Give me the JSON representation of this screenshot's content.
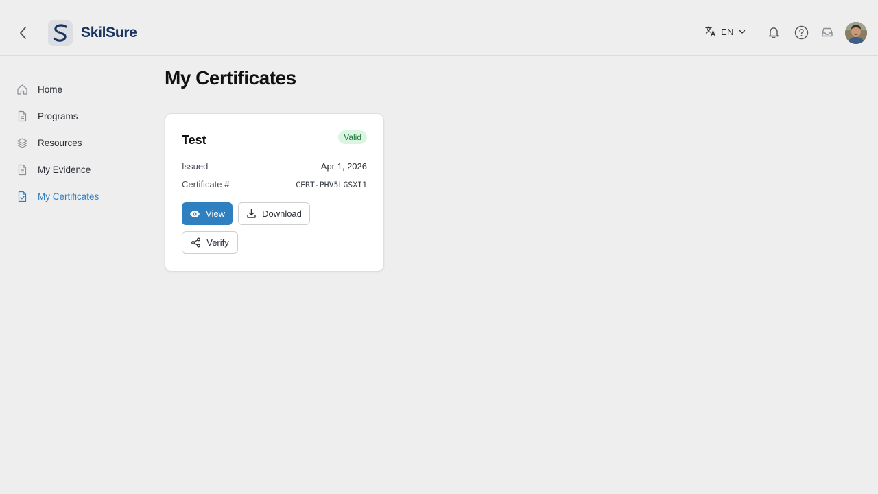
{
  "header": {
    "brand": "SkilSure",
    "language": {
      "code": "EN"
    },
    "icons": [
      "chevron-left-icon",
      "translate-icon",
      "chevron-down-icon",
      "bell-icon",
      "help-icon",
      "inbox-icon"
    ]
  },
  "sidebar": {
    "items": [
      {
        "label": "Home",
        "icon": "home-icon",
        "active": false
      },
      {
        "label": "Programs",
        "icon": "document-icon",
        "active": false
      },
      {
        "label": "Resources",
        "icon": "layers-icon",
        "active": false
      },
      {
        "label": "My Evidence",
        "icon": "document-icon",
        "active": false
      },
      {
        "label": "My Certificates",
        "icon": "certificate-icon",
        "active": true
      }
    ]
  },
  "main": {
    "title": "My Certificates",
    "certificates": [
      {
        "name": "Test",
        "status": "Valid",
        "issued_label": "Issued",
        "issued_value": "Apr 1, 2026",
        "number_label": "Certificate #",
        "number_value": "CERT-PHV5LGSXI1",
        "actions": {
          "view": "View",
          "download": "Download",
          "verify": "Verify"
        }
      }
    ]
  },
  "colors": {
    "background": "#eeeeee",
    "accent": "#2f80c0",
    "active_nav": "#2f7fc1",
    "brand_text": "#1a3560",
    "valid_badge_bg": "#dcf5e3",
    "valid_badge_text": "#1f7a3b"
  }
}
